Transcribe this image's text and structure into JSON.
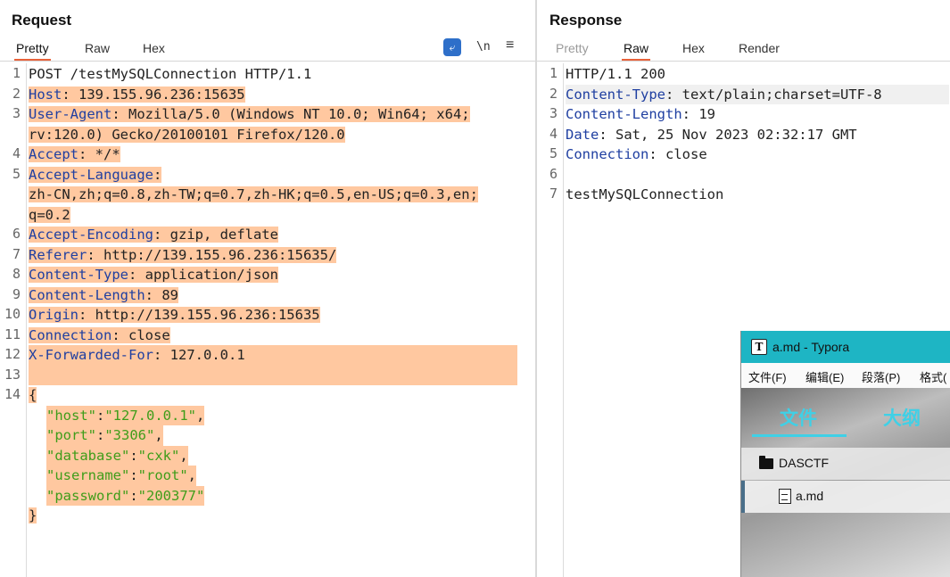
{
  "request": {
    "title": "Request",
    "tabs": [
      "Pretty",
      "Raw",
      "Hex"
    ],
    "active_tab": "Pretty",
    "tools": {
      "newline": "\\n",
      "menu": "≡"
    },
    "lines": [
      {
        "n": "1",
        "text": "POST /testMySQLConnection HTTP/1.1"
      },
      {
        "n": "2",
        "key": "Host",
        "val": " 139.155.96.236:15635"
      },
      {
        "n": "3",
        "key": "User-Agent",
        "val": " Mozilla/5.0 (Windows NT 10.0; Win64; x64;"
      },
      {
        "n": "",
        "text": "rv:120.0) Gecko/20100101 Firefox/120.0"
      },
      {
        "n": "4",
        "key": "Accept",
        "val": " */*"
      },
      {
        "n": "5",
        "key": "Accept-Language",
        "val": ""
      },
      {
        "n": "",
        "text": "zh-CN,zh;q=0.8,zh-TW;q=0.7,zh-HK;q=0.5,en-US;q=0.3,en;"
      },
      {
        "n": "",
        "text": "q=0.2"
      },
      {
        "n": "6",
        "key": "Accept-Encoding",
        "val": " gzip, deflate"
      },
      {
        "n": "7",
        "key": "Referer",
        "val": " http://139.155.96.236:15635/"
      },
      {
        "n": "8",
        "key": "Content-Type",
        "val": " application/json"
      },
      {
        "n": "9",
        "key": "Content-Length",
        "val": " 89"
      },
      {
        "n": "10",
        "key": "Origin",
        "val": " http://139.155.96.236:15635"
      },
      {
        "n": "11",
        "key": "Connection",
        "val": " close"
      },
      {
        "n": "12",
        "key": "X-Forwarded-For",
        "val": " 127.0.0.1"
      },
      {
        "n": "13",
        "text": ""
      },
      {
        "n": "14",
        "text": "{"
      },
      {
        "n": "",
        "json_key": "\"host\"",
        "json_val": "\"127.0.0.1\"",
        "tail": ","
      },
      {
        "n": "",
        "json_key": "\"port\"",
        "json_val": "\"3306\"",
        "tail": ","
      },
      {
        "n": "",
        "json_key": "\"database\"",
        "json_val": "\"cxk\"",
        "tail": ","
      },
      {
        "n": "",
        "json_key": "\"username\"",
        "json_val": "\"root\"",
        "tail": ","
      },
      {
        "n": "",
        "json_key": "\"password\"",
        "json_val": "\"200377\"",
        "tail": ""
      },
      {
        "n": "",
        "text": "}"
      }
    ]
  },
  "response": {
    "title": "Response",
    "tabs": [
      "Pretty",
      "Raw",
      "Hex",
      "Render"
    ],
    "active_tab": "Raw",
    "lines": [
      {
        "n": "1",
        "text": "HTTP/1.1 200"
      },
      {
        "n": "2",
        "key": "Content-Type",
        "val": " text/plain;charset=UTF-8"
      },
      {
        "n": "3",
        "key": "Content-Length",
        "val": " 19"
      },
      {
        "n": "4",
        "key": "Date",
        "val": " Sat, 25 Nov 2023 02:32:17 GMT"
      },
      {
        "n": "5",
        "key": "Connection",
        "val": " close"
      },
      {
        "n": "6",
        "text": ""
      },
      {
        "n": "7",
        "text": "testMySQLConnection"
      }
    ]
  },
  "typora": {
    "logo": "T",
    "title": "a.md - Typora",
    "menu": [
      "文件(F)",
      "编辑(E)",
      "段落(P)",
      "格式("
    ],
    "sidebar_tabs": [
      "文件",
      "大纲"
    ],
    "folder": "DASCTF",
    "file": "a.md"
  },
  "colors": {
    "highlight": "#ffc8a0",
    "header_key": "#1f3fa1",
    "json_string": "#3f9d1a",
    "accent_tab": "#e8623a",
    "typora_title": "#1eb5c4"
  }
}
